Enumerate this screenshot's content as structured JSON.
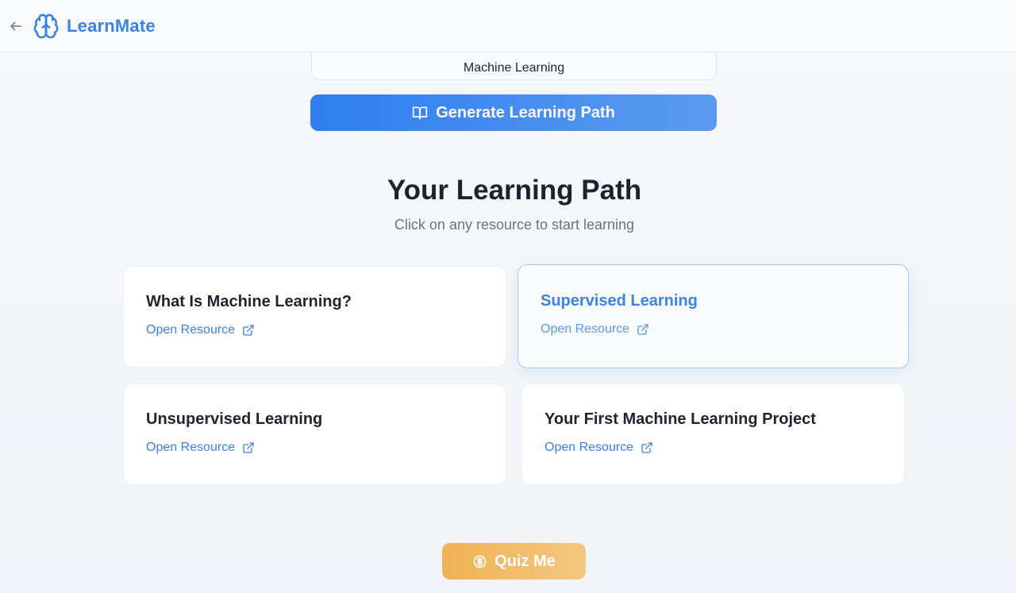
{
  "app": {
    "name": "LearnMate"
  },
  "header": {
    "back_icon": "arrow-left-icon",
    "logo_icon": "brain-icon"
  },
  "topic": {
    "value": "Machine Learning"
  },
  "generate_button": {
    "label": "Generate Learning Path",
    "icon": "book-open-icon"
  },
  "learning_path": {
    "title": "Your Learning Path",
    "subtitle": "Click on any resource to start learning",
    "resources": [
      {
        "title": "What Is Machine Learning?",
        "link_label": "Open Resource",
        "active": false
      },
      {
        "title": "Supervised Learning",
        "link_label": "Open Resource",
        "active": true
      },
      {
        "title": "Unsupervised Learning",
        "link_label": "Open Resource",
        "active": false
      },
      {
        "title": "Your First Machine Learning Project",
        "link_label": "Open Resource",
        "active": false
      }
    ],
    "link_icon": "external-link-icon"
  },
  "quiz_button": {
    "label": "Quiz Me",
    "icon": "brain-icon"
  },
  "colors": {
    "accent": "#3b82e6",
    "quiz": "#efb253",
    "title_text": "#1c2230",
    "subtitle_text": "#6b7383"
  }
}
